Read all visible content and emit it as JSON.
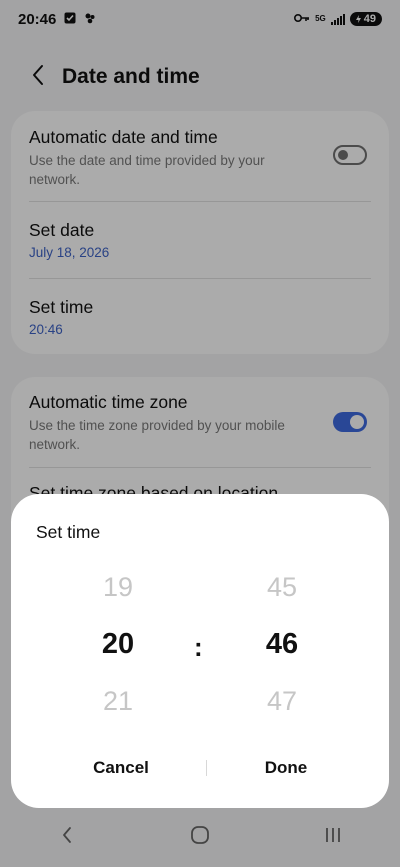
{
  "status_bar": {
    "time": "20:46",
    "network_label": "5G",
    "battery_level": "49",
    "icons": [
      "checkbox-notification-icon",
      "bluetooth-icon",
      "key-icon",
      "5g-icon",
      "signal-icon",
      "battery-icon"
    ]
  },
  "header": {
    "title": "Date and time",
    "back_icon": "back-arrow-icon"
  },
  "settings": {
    "auto_datetime": {
      "title": "Automatic date and time",
      "subtitle": "Use the date and time provided by your network.",
      "enabled": false
    },
    "set_date": {
      "title": "Set date",
      "value": "July 18, 2026"
    },
    "set_time": {
      "title": "Set time",
      "value": "20:46"
    },
    "auto_timezone": {
      "title": "Automatic time zone",
      "subtitle": "Use the time zone provided by your mobile network.",
      "enabled": true
    },
    "set_tz_location": {
      "title": "Set time zone based on location"
    }
  },
  "dialog": {
    "title": "Set time",
    "hours": {
      "prev": "19",
      "selected": "20",
      "next": "21"
    },
    "separator": ":",
    "minutes": {
      "prev": "45",
      "selected": "46",
      "next": "47"
    },
    "cancel_label": "Cancel",
    "done_label": "Done"
  },
  "nav": {
    "icons": [
      "back-nav-icon",
      "home-nav-icon",
      "recents-nav-icon"
    ]
  },
  "colors": {
    "accent": "#3e63c6",
    "toggle_on": "#3e6be0",
    "background": "#f3f3f5"
  }
}
